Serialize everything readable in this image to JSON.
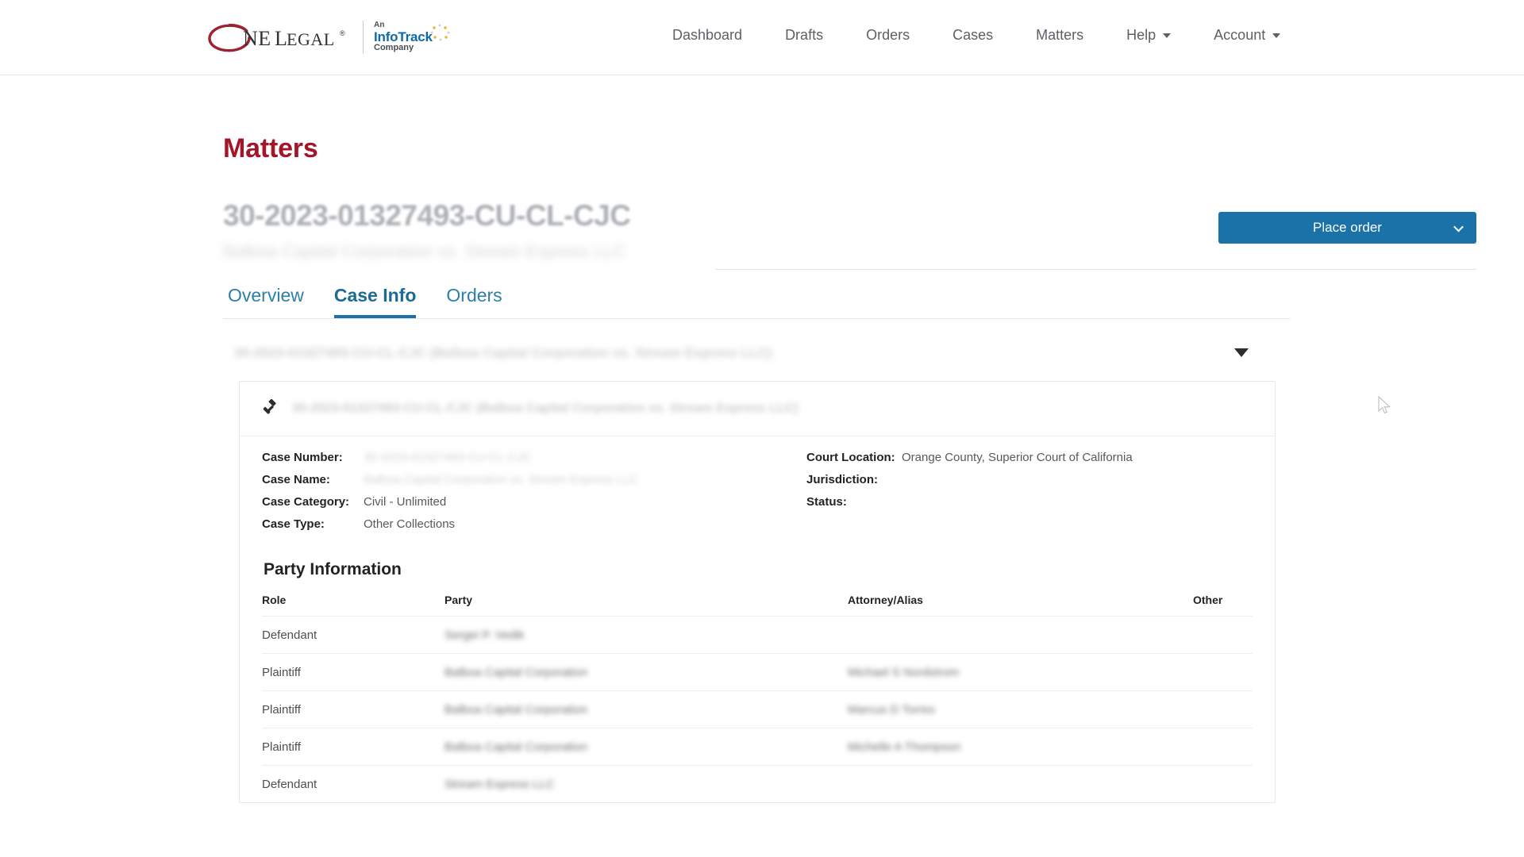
{
  "brand": {
    "name": "ONE LEGAL",
    "logo_mark": "one-legal-swoosh",
    "partner_an": "An",
    "partner_name": "InfoTrack",
    "partner_company": "Company",
    "accent_red": "#a3162a",
    "accent_blue": "#1a72a8"
  },
  "nav": {
    "items": [
      {
        "label": "Dashboard",
        "has_caret": false
      },
      {
        "label": "Drafts",
        "has_caret": false
      },
      {
        "label": "Orders",
        "has_caret": false
      },
      {
        "label": "Cases",
        "has_caret": false
      },
      {
        "label": "Matters",
        "has_caret": false
      },
      {
        "label": "Help",
        "has_caret": true
      },
      {
        "label": "Account",
        "has_caret": true
      }
    ]
  },
  "page": {
    "title": "Matters",
    "case_number": "30-2023-01327493-CU-CL-CJC",
    "case_subtitle": "Balboa Capital Corporation vs. Stream Express LLC"
  },
  "actions": {
    "place_order_label": "Place order",
    "place_order_icon": "chevron-down-icon"
  },
  "tabs": [
    {
      "label": "Overview",
      "active": false
    },
    {
      "label": "Case Info",
      "active": true
    },
    {
      "label": "Orders",
      "active": false
    }
  ],
  "accordion": {
    "title": "30-2023-01327493-CU-CL-CJC (Balboa Capital Corporation vs. Stream Express LLC)",
    "toggle_icon": "caret-down-icon",
    "expanded": true
  },
  "card": {
    "header_icon": "gavel-icon",
    "header_text": "30-2023-01327493-CU-CL-CJC (Balboa Capital Corporation vs. Stream Express LLC)",
    "fields_left": [
      {
        "label": "Case Number:",
        "value": "30-2023-01327493-CU-CL-CJC",
        "redacted": true
      },
      {
        "label": "Case Name:",
        "value": "Balboa Capital Corporation vs. Stream Express LLC",
        "redacted": true
      },
      {
        "label": "Case Category:",
        "value": "Civil - Unlimited",
        "redacted": false
      },
      {
        "label": "Case Type:",
        "value": "Other Collections",
        "redacted": false
      }
    ],
    "fields_right": [
      {
        "label": "Court Location:",
        "value": "Orange County, Superior Court of California",
        "redacted": false
      },
      {
        "label": "Jurisdiction:",
        "value": "",
        "redacted": false
      },
      {
        "label": "Status:",
        "value": "",
        "redacted": false
      }
    ],
    "party_information": {
      "heading": "Party Information",
      "columns": [
        "Role",
        "Party",
        "Attorney/Alias",
        "Other"
      ],
      "rows": [
        {
          "role": "Defendant",
          "party": "Sergei P. Vedik",
          "attorney": "",
          "other": "",
          "party_redacted": true,
          "attorney_redacted": false
        },
        {
          "role": "Plaintiff",
          "party": "Balboa Capital Corporation",
          "attorney": "Michael S Nordstrom",
          "other": "",
          "party_redacted": true,
          "attorney_redacted": true
        },
        {
          "role": "Plaintiff",
          "party": "Balboa Capital Corporation",
          "attorney": "Marcus D Torres",
          "other": "",
          "party_redacted": true,
          "attorney_redacted": true
        },
        {
          "role": "Plaintiff",
          "party": "Balboa Capital Corporation",
          "attorney": "Michelle A Thompson",
          "other": "",
          "party_redacted": true,
          "attorney_redacted": true
        },
        {
          "role": "Defendant",
          "party": "Stream Express LLC",
          "attorney": "",
          "other": "",
          "party_redacted": true,
          "attorney_redacted": false
        }
      ]
    }
  }
}
